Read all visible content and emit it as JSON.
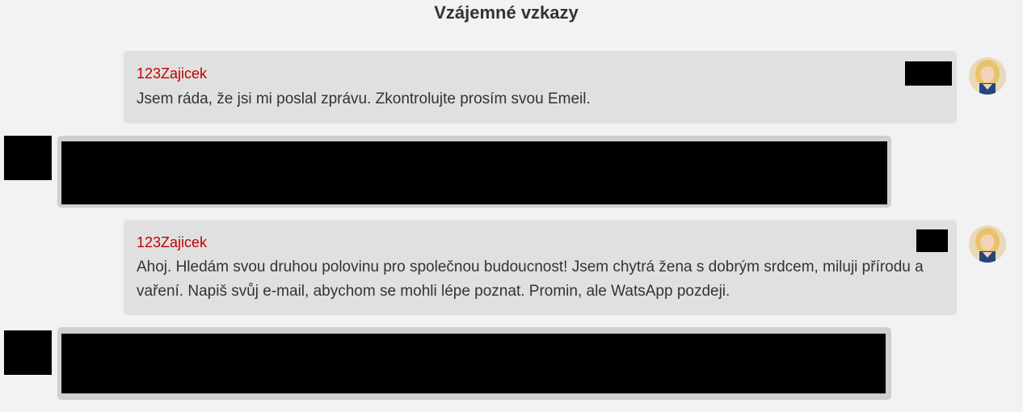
{
  "page": {
    "title": "Vzájemné vzkazy"
  },
  "messages": [
    {
      "sender": "123Zajicek",
      "text": "Jsem ráda, že jsi mi poslal zprávu. Zkontrolujte prosím svou Emeil.",
      "avatar": "woman-avatar"
    },
    {
      "redacted": true
    },
    {
      "sender": "123Zajicek",
      "text_line1": "Ahoj. Hledám svou druhou polovinu pro společnou budoucnost! Jsem chytrá žena s dobrým srdcem, miluji přírodu a",
      "text_line2": "vaření. Napiš svůj e-mail, abychom se mohli lépe poznat. Promin, ale WatsApp pozdeji.",
      "avatar": "woman-avatar"
    },
    {
      "redacted": true
    }
  ],
  "colors": {
    "background": "#f2f2f2",
    "bubble_incoming": "#e0e0e0",
    "bubble_outgoing_border": "#cfcfcf",
    "sender": "#c00000",
    "text": "#333333",
    "redaction": "#000000"
  }
}
